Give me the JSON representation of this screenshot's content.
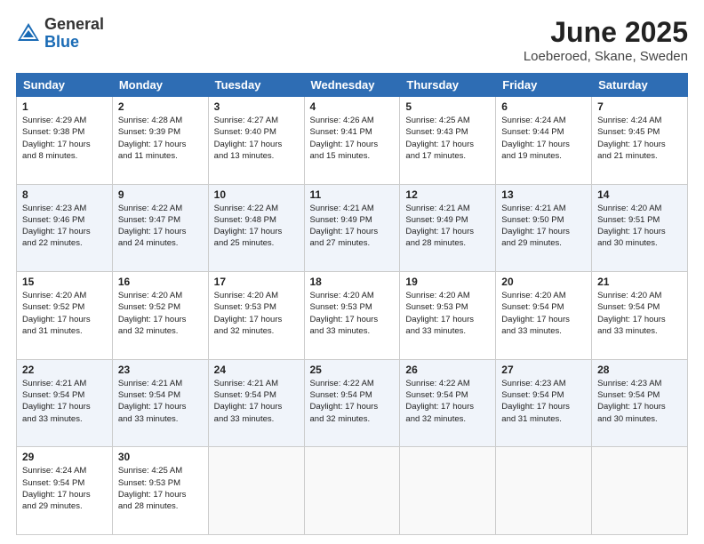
{
  "header": {
    "logo_general": "General",
    "logo_blue": "Blue",
    "month_title": "June 2025",
    "location": "Loeberoed, Skane, Sweden"
  },
  "columns": [
    "Sunday",
    "Monday",
    "Tuesday",
    "Wednesday",
    "Thursday",
    "Friday",
    "Saturday"
  ],
  "weeks": [
    [
      {
        "day": "1",
        "lines": [
          "Sunrise: 4:29 AM",
          "Sunset: 9:38 PM",
          "Daylight: 17 hours",
          "and 8 minutes."
        ]
      },
      {
        "day": "2",
        "lines": [
          "Sunrise: 4:28 AM",
          "Sunset: 9:39 PM",
          "Daylight: 17 hours",
          "and 11 minutes."
        ]
      },
      {
        "day": "3",
        "lines": [
          "Sunrise: 4:27 AM",
          "Sunset: 9:40 PM",
          "Daylight: 17 hours",
          "and 13 minutes."
        ]
      },
      {
        "day": "4",
        "lines": [
          "Sunrise: 4:26 AM",
          "Sunset: 9:41 PM",
          "Daylight: 17 hours",
          "and 15 minutes."
        ]
      },
      {
        "day": "5",
        "lines": [
          "Sunrise: 4:25 AM",
          "Sunset: 9:43 PM",
          "Daylight: 17 hours",
          "and 17 minutes."
        ]
      },
      {
        "day": "6",
        "lines": [
          "Sunrise: 4:24 AM",
          "Sunset: 9:44 PM",
          "Daylight: 17 hours",
          "and 19 minutes."
        ]
      },
      {
        "day": "7",
        "lines": [
          "Sunrise: 4:24 AM",
          "Sunset: 9:45 PM",
          "Daylight: 17 hours",
          "and 21 minutes."
        ]
      }
    ],
    [
      {
        "day": "8",
        "lines": [
          "Sunrise: 4:23 AM",
          "Sunset: 9:46 PM",
          "Daylight: 17 hours",
          "and 22 minutes."
        ]
      },
      {
        "day": "9",
        "lines": [
          "Sunrise: 4:22 AM",
          "Sunset: 9:47 PM",
          "Daylight: 17 hours",
          "and 24 minutes."
        ]
      },
      {
        "day": "10",
        "lines": [
          "Sunrise: 4:22 AM",
          "Sunset: 9:48 PM",
          "Daylight: 17 hours",
          "and 25 minutes."
        ]
      },
      {
        "day": "11",
        "lines": [
          "Sunrise: 4:21 AM",
          "Sunset: 9:49 PM",
          "Daylight: 17 hours",
          "and 27 minutes."
        ]
      },
      {
        "day": "12",
        "lines": [
          "Sunrise: 4:21 AM",
          "Sunset: 9:49 PM",
          "Daylight: 17 hours",
          "and 28 minutes."
        ]
      },
      {
        "day": "13",
        "lines": [
          "Sunrise: 4:21 AM",
          "Sunset: 9:50 PM",
          "Daylight: 17 hours",
          "and 29 minutes."
        ]
      },
      {
        "day": "14",
        "lines": [
          "Sunrise: 4:20 AM",
          "Sunset: 9:51 PM",
          "Daylight: 17 hours",
          "and 30 minutes."
        ]
      }
    ],
    [
      {
        "day": "15",
        "lines": [
          "Sunrise: 4:20 AM",
          "Sunset: 9:52 PM",
          "Daylight: 17 hours",
          "and 31 minutes."
        ]
      },
      {
        "day": "16",
        "lines": [
          "Sunrise: 4:20 AM",
          "Sunset: 9:52 PM",
          "Daylight: 17 hours",
          "and 32 minutes."
        ]
      },
      {
        "day": "17",
        "lines": [
          "Sunrise: 4:20 AM",
          "Sunset: 9:53 PM",
          "Daylight: 17 hours",
          "and 32 minutes."
        ]
      },
      {
        "day": "18",
        "lines": [
          "Sunrise: 4:20 AM",
          "Sunset: 9:53 PM",
          "Daylight: 17 hours",
          "and 33 minutes."
        ]
      },
      {
        "day": "19",
        "lines": [
          "Sunrise: 4:20 AM",
          "Sunset: 9:53 PM",
          "Daylight: 17 hours",
          "and 33 minutes."
        ]
      },
      {
        "day": "20",
        "lines": [
          "Sunrise: 4:20 AM",
          "Sunset: 9:54 PM",
          "Daylight: 17 hours",
          "and 33 minutes."
        ]
      },
      {
        "day": "21",
        "lines": [
          "Sunrise: 4:20 AM",
          "Sunset: 9:54 PM",
          "Daylight: 17 hours",
          "and 33 minutes."
        ]
      }
    ],
    [
      {
        "day": "22",
        "lines": [
          "Sunrise: 4:21 AM",
          "Sunset: 9:54 PM",
          "Daylight: 17 hours",
          "and 33 minutes."
        ]
      },
      {
        "day": "23",
        "lines": [
          "Sunrise: 4:21 AM",
          "Sunset: 9:54 PM",
          "Daylight: 17 hours",
          "and 33 minutes."
        ]
      },
      {
        "day": "24",
        "lines": [
          "Sunrise: 4:21 AM",
          "Sunset: 9:54 PM",
          "Daylight: 17 hours",
          "and 33 minutes."
        ]
      },
      {
        "day": "25",
        "lines": [
          "Sunrise: 4:22 AM",
          "Sunset: 9:54 PM",
          "Daylight: 17 hours",
          "and 32 minutes."
        ]
      },
      {
        "day": "26",
        "lines": [
          "Sunrise: 4:22 AM",
          "Sunset: 9:54 PM",
          "Daylight: 17 hours",
          "and 32 minutes."
        ]
      },
      {
        "day": "27",
        "lines": [
          "Sunrise: 4:23 AM",
          "Sunset: 9:54 PM",
          "Daylight: 17 hours",
          "and 31 minutes."
        ]
      },
      {
        "day": "28",
        "lines": [
          "Sunrise: 4:23 AM",
          "Sunset: 9:54 PM",
          "Daylight: 17 hours",
          "and 30 minutes."
        ]
      }
    ],
    [
      {
        "day": "29",
        "lines": [
          "Sunrise: 4:24 AM",
          "Sunset: 9:54 PM",
          "Daylight: 17 hours",
          "and 29 minutes."
        ]
      },
      {
        "day": "30",
        "lines": [
          "Sunrise: 4:25 AM",
          "Sunset: 9:53 PM",
          "Daylight: 17 hours",
          "and 28 minutes."
        ]
      },
      null,
      null,
      null,
      null,
      null
    ]
  ]
}
